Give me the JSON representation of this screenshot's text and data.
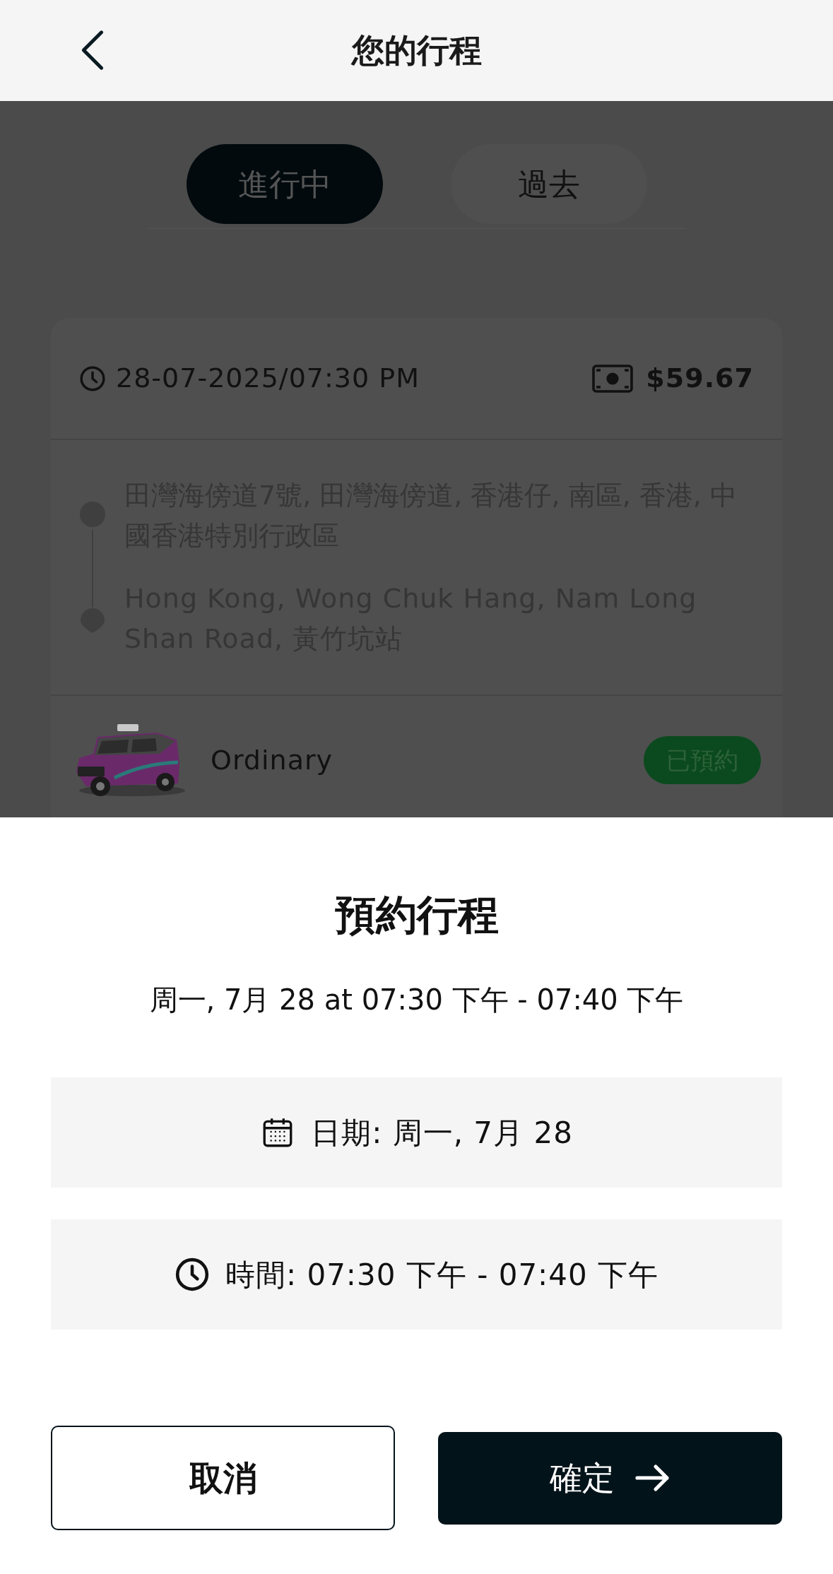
{
  "header": {
    "title": "您的行程"
  },
  "tabs": [
    {
      "label": "進行中",
      "selected": true
    },
    {
      "label": "過去",
      "selected": false
    }
  ],
  "trip": {
    "datetime": "28-07-2025/07:30 PM",
    "fare": "$59.67",
    "pickup": "田灣海傍道7號, 田灣海傍道, 香港仔, 南區, 香港, 中國香港特別行政區",
    "dropoff": "Hong Kong, Wong Chuk Hang, Nam Long Shan Road, 黃竹坑站",
    "vehicle": "Ordinary",
    "status": "已預約"
  },
  "sheet": {
    "title": "預約行程",
    "summary": "周一, 7月 28 at 07:30 下午 - 07:40 下午",
    "rows": [
      {
        "kind": "date",
        "label": "日期: 周一, 7月 28"
      },
      {
        "kind": "time",
        "label": "時間: 07:30 下午 - 07:40 下午"
      }
    ],
    "buttons": [
      {
        "kind": "cancel",
        "label": "取消"
      },
      {
        "kind": "confirm",
        "label": "確定"
      }
    ]
  }
}
